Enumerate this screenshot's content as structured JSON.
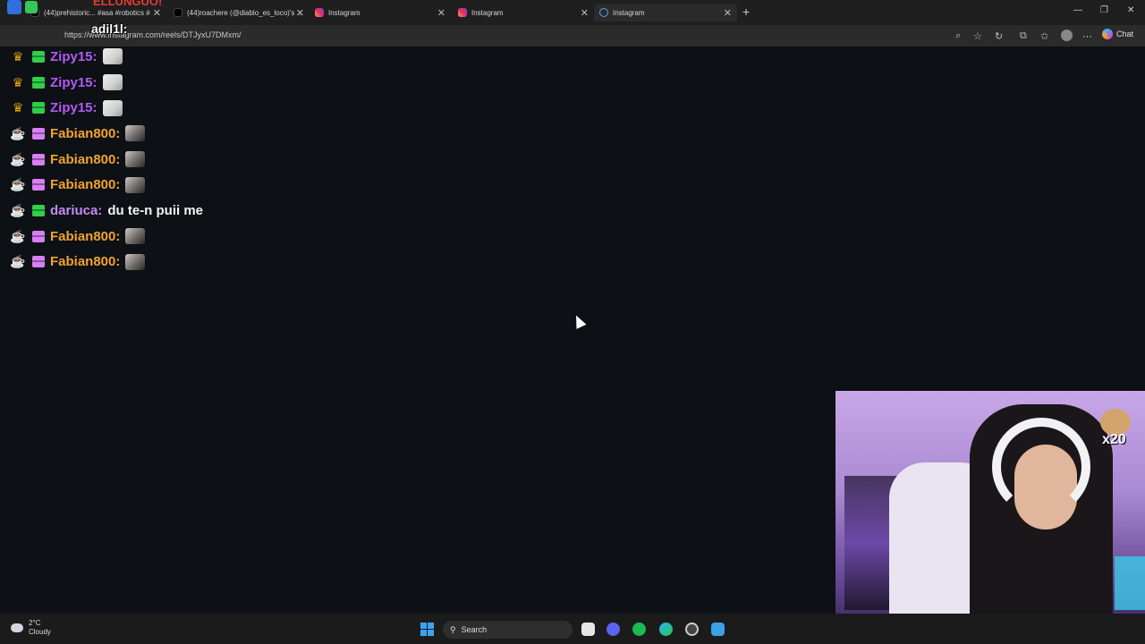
{
  "tabs": [
    {
      "title": "(44)prehistoric... #asa #robotics #",
      "icon": "tiktok-icon"
    },
    {
      "title": "(44)roachere (@diablo_es_loco)'s ...",
      "icon": "tiktok-icon"
    },
    {
      "title": "Instagram",
      "icon": "instagram-icon"
    },
    {
      "title": "Instagram",
      "icon": "instagram-icon"
    },
    {
      "title": "Instagram",
      "icon": "loading-icon"
    }
  ],
  "address": {
    "url": "https://www.instagram.com/reels/DTJyxU7DMxm/"
  },
  "toolbar": {
    "chat_label": "Chat"
  },
  "overlay": {
    "top_name": "adil1l:",
    "red_text": "ELLUNGUO!"
  },
  "chat": {
    "messages": [
      {
        "badge": "crown-icon",
        "gift": "green",
        "user": "Zipy15:",
        "color": "#b25af7",
        "text": "",
        "emote": "cat"
      },
      {
        "badge": "crown-icon",
        "gift": "green",
        "user": "Zipy15:",
        "color": "#b25af7",
        "text": "",
        "emote": "cat"
      },
      {
        "badge": "crown-icon",
        "gift": "green",
        "user": "Zipy15:",
        "color": "#b25af7",
        "text": "",
        "emote": "cat"
      },
      {
        "badge": "coffee-icon",
        "gift": "pink",
        "user": "Fabian800:",
        "color": "#f0a32f",
        "text": "",
        "emote": "fab"
      },
      {
        "badge": "coffee-icon",
        "gift": "pink",
        "user": "Fabian800:",
        "color": "#f0a32f",
        "text": "",
        "emote": "fab"
      },
      {
        "badge": "coffee-icon",
        "gift": "pink",
        "user": "Fabian800:",
        "color": "#f0a32f",
        "text": "",
        "emote": "fab"
      },
      {
        "badge": "coffee-icon",
        "gift": "green",
        "user": "dariuca:",
        "color": "#c58af5",
        "text": "du te-n puii me",
        "emote": ""
      },
      {
        "badge": "coffee-icon",
        "gift": "pink",
        "user": "Fabian800:",
        "color": "#f0a32f",
        "text": "",
        "emote": "fab"
      },
      {
        "badge": "coffee-icon",
        "gift": "pink",
        "user": "Fabian800:",
        "color": "#f0a32f",
        "text": "",
        "emote": "fab"
      }
    ]
  },
  "webcam": {
    "gift_count": "x20"
  },
  "taskbar": {
    "temp": "2°C",
    "weather": "Cloudy",
    "search_label": "Search"
  }
}
